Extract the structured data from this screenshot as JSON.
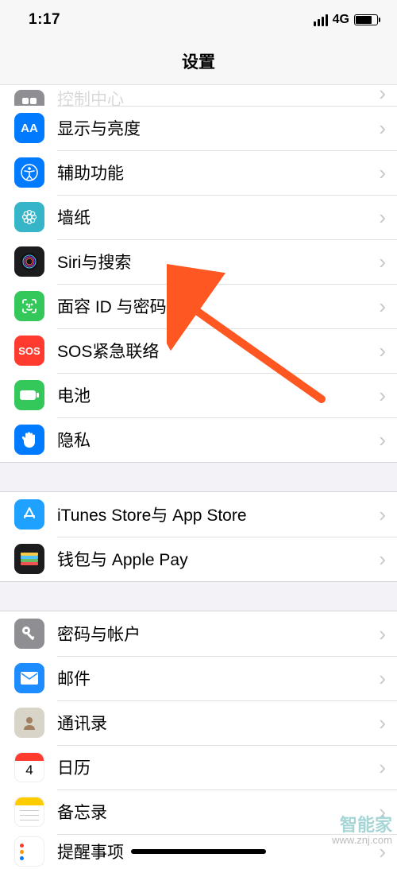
{
  "status": {
    "time": "1:17",
    "network": "4G"
  },
  "header": {
    "title": "设置"
  },
  "groups": [
    {
      "id": "general",
      "items": [
        {
          "key": "control",
          "label": "控制中心",
          "partial_top": true
        },
        {
          "key": "display",
          "label": "显示与亮度"
        },
        {
          "key": "accessibility",
          "label": "辅助功能"
        },
        {
          "key": "wallpaper",
          "label": "墙纸"
        },
        {
          "key": "siri",
          "label": "Siri与搜索"
        },
        {
          "key": "faceid",
          "label": "面容 ID 与密码"
        },
        {
          "key": "sos",
          "label": "SOS紧急联络",
          "icon_text": "SOS"
        },
        {
          "key": "battery",
          "label": "电池"
        },
        {
          "key": "privacy",
          "label": "隐私"
        }
      ]
    },
    {
      "id": "store",
      "items": [
        {
          "key": "appstore",
          "label": "iTunes Store与 App Store"
        },
        {
          "key": "wallet",
          "label": "钱包与 Apple Pay"
        }
      ]
    },
    {
      "id": "accounts",
      "items": [
        {
          "key": "passwords",
          "label": "密码与帐户"
        },
        {
          "key": "mail",
          "label": "邮件"
        },
        {
          "key": "contacts",
          "label": "通讯录"
        },
        {
          "key": "calendar",
          "label": "日历"
        },
        {
          "key": "notes",
          "label": "备忘录"
        },
        {
          "key": "reminders",
          "label": "提醒事项",
          "partial_bottom": true
        }
      ]
    }
  ],
  "annotation": {
    "arrow_target": "faceid"
  },
  "watermark": {
    "text": "智能家",
    "sub": "www.znj.com"
  }
}
